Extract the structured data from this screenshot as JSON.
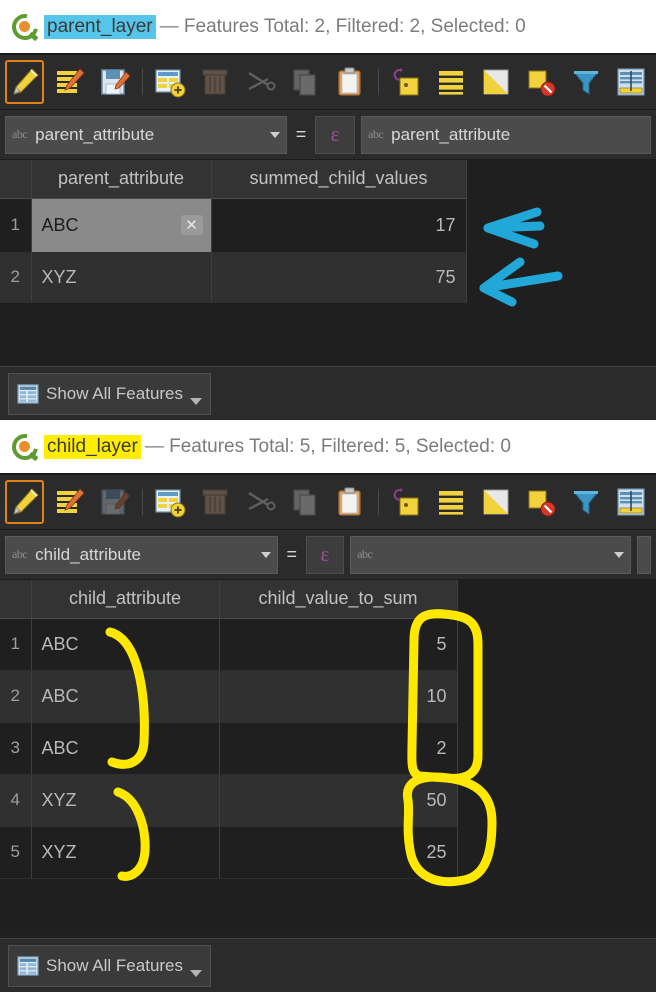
{
  "parent_window": {
    "title": {
      "layer": "parent_layer",
      "stats": "— Features Total: 2, Filtered: 2, Selected: 0",
      "highlight_color": "#56c5ea"
    },
    "logo_name": "qgis-logo",
    "toolbar": [
      {
        "name": "toggle-editing-icon",
        "label": "Toggle Editing Mode",
        "state": "active"
      },
      {
        "name": "multi-edit-icon",
        "label": "Multi Edit Attributes",
        "state": "enabled"
      },
      {
        "name": "save-edits-icon",
        "label": "Save Edits",
        "state": "enabled"
      },
      {
        "name": "separator",
        "label": "",
        "state": "separator"
      },
      {
        "name": "new-field-icon",
        "label": "New Field",
        "state": "enabled"
      },
      {
        "name": "delete-field-icon",
        "label": "Delete Field",
        "state": "disabled"
      },
      {
        "name": "cut-features-icon",
        "label": "Cut Features",
        "state": "disabled"
      },
      {
        "name": "copy-features-icon",
        "label": "Copy Features",
        "state": "disabled"
      },
      {
        "name": "paste-features-icon",
        "label": "Paste Features",
        "state": "enabled"
      },
      {
        "name": "separator",
        "label": "",
        "state": "separator"
      },
      {
        "name": "zoom-map-to-selected-icon",
        "label": "Zoom Map To Selected Rows",
        "state": "enabled"
      },
      {
        "name": "select-all-icon",
        "label": "Select All",
        "state": "enabled"
      },
      {
        "name": "invert-selection-icon",
        "label": "Invert Selection",
        "state": "enabled"
      },
      {
        "name": "deselect-all-icon",
        "label": "Deselect All",
        "state": "enabled"
      },
      {
        "name": "filter-expression-icon",
        "label": "Select Features Using Expression",
        "state": "enabled"
      },
      {
        "name": "open-field-calculator-icon",
        "label": "Open Field Calculator",
        "state": "enabled"
      }
    ],
    "filter": {
      "field_prefix": "abc",
      "field_value": "parent_attribute",
      "operator": "=",
      "expression_glyph": "ε",
      "value_prefix": "abc",
      "value_text": "parent_attribute"
    },
    "table": {
      "columns": [
        "parent_attribute",
        "summed_child_values"
      ],
      "rows": [
        {
          "num": "1",
          "parent_attribute": "ABC",
          "summed_child_values": "17",
          "editing": true,
          "clear_glyph": "✕"
        },
        {
          "num": "2",
          "parent_attribute": "XYZ",
          "summed_child_values": "75",
          "editing": false,
          "clear_glyph": ""
        }
      ]
    },
    "footer": {
      "show_all_label": "Show All Features",
      "icon": "table-view-icon"
    }
  },
  "child_window": {
    "title": {
      "layer": "child_layer",
      "stats": "— Features Total: 5, Filtered: 5, Selected: 0",
      "highlight_color": "#ffed00"
    },
    "logo_name": "qgis-logo",
    "toolbar": [
      {
        "name": "toggle-editing-icon",
        "label": "Toggle Editing Mode",
        "state": "active"
      },
      {
        "name": "multi-edit-icon",
        "label": "Multi Edit Attributes",
        "state": "enabled"
      },
      {
        "name": "save-edits-icon",
        "label": "Save Edits",
        "state": "disabled"
      },
      {
        "name": "separator",
        "label": "",
        "state": "separator"
      },
      {
        "name": "new-field-icon",
        "label": "New Field",
        "state": "enabled"
      },
      {
        "name": "delete-field-icon",
        "label": "Delete Field",
        "state": "disabled"
      },
      {
        "name": "cut-features-icon",
        "label": "Cut Features",
        "state": "disabled"
      },
      {
        "name": "copy-features-icon",
        "label": "Copy Features",
        "state": "disabled"
      },
      {
        "name": "paste-features-icon",
        "label": "Paste Features",
        "state": "enabled"
      },
      {
        "name": "separator",
        "label": "",
        "state": "separator"
      },
      {
        "name": "zoom-map-to-selected-icon",
        "label": "Zoom Map To Selected Rows",
        "state": "enabled"
      },
      {
        "name": "select-all-icon",
        "label": "Select All",
        "state": "enabled"
      },
      {
        "name": "invert-selection-icon",
        "label": "Invert Selection",
        "state": "enabled"
      },
      {
        "name": "deselect-all-icon",
        "label": "Deselect All",
        "state": "enabled"
      },
      {
        "name": "filter-expression-icon",
        "label": "Select Features Using Expression",
        "state": "enabled"
      },
      {
        "name": "open-field-calculator-icon",
        "label": "Open Field Calculator",
        "state": "enabled"
      }
    ],
    "filter": {
      "field_prefix": "abc",
      "field_value": "child_attribute",
      "operator": "=",
      "expression_glyph": "ε",
      "value_prefix": "abc",
      "value_text": ""
    },
    "table": {
      "columns": [
        "child_attribute",
        "child_value_to_sum"
      ],
      "rows": [
        {
          "num": "1",
          "child_attribute": "ABC",
          "child_value_to_sum": "5"
        },
        {
          "num": "2",
          "child_attribute": "ABC",
          "child_value_to_sum": "10"
        },
        {
          "num": "3",
          "child_attribute": "ABC",
          "child_value_to_sum": "2"
        },
        {
          "num": "4",
          "child_attribute": "XYZ",
          "child_value_to_sum": "50"
        },
        {
          "num": "5",
          "child_attribute": "XYZ",
          "child_value_to_sum": "25"
        }
      ]
    },
    "footer": {
      "show_all_label": "Show All Features",
      "icon": "table-view-icon"
    }
  },
  "annotations": {
    "arrow_color": "#21a8d8",
    "brace_color": "#ffe800",
    "items": [
      {
        "name": "arrow-to-sum-17",
        "type": "arrow",
        "color": "#21a8d8"
      },
      {
        "name": "arrow-to-sum-75",
        "type": "arrow",
        "color": "#21a8d8"
      },
      {
        "name": "brace-abc-group",
        "type": "brace",
        "color": "#ffe800"
      },
      {
        "name": "brace-xyz-group",
        "type": "brace",
        "color": "#ffe800"
      },
      {
        "name": "circle-abc-values",
        "type": "circle",
        "color": "#ffe800"
      },
      {
        "name": "circle-xyz-values",
        "type": "circle",
        "color": "#ffe800"
      }
    ]
  }
}
